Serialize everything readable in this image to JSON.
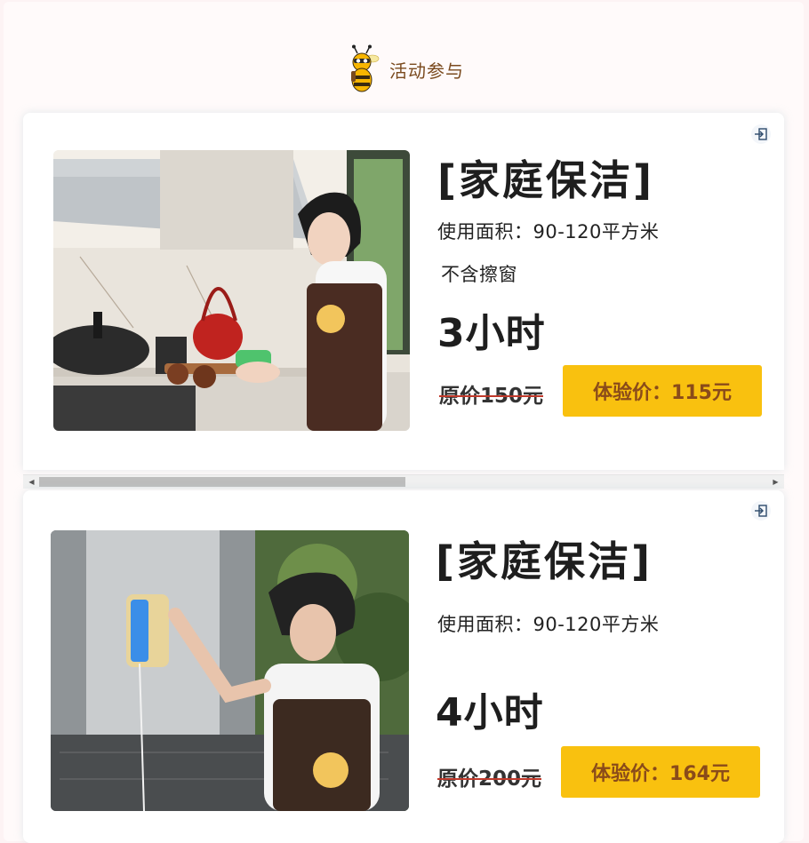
{
  "header": {
    "title": "活动参与",
    "logo_icon": "bee-mascot-icon"
  },
  "cards": [
    {
      "title": "[家庭保洁]",
      "area": "使用面积：90-120平方米",
      "note": "不含擦窗",
      "hours": "3小时",
      "original_price": "原价150元",
      "trial_price": "体验价：115元",
      "image": "kitchen-cleaning-photo",
      "action_icon": "login-icon"
    },
    {
      "title": "[家庭保洁]",
      "area": "使用面积：90-120平方米",
      "note": "",
      "hours": "4小时",
      "original_price": "原价200元",
      "trial_price": "体验价：164元",
      "image": "window-cleaning-photo",
      "action_icon": "login-icon"
    }
  ],
  "colors": {
    "accent_button": "#f9c10f",
    "button_text": "#8a4b1a",
    "strike_line": "#c0392b",
    "page_bg": "#fdf3f4"
  }
}
